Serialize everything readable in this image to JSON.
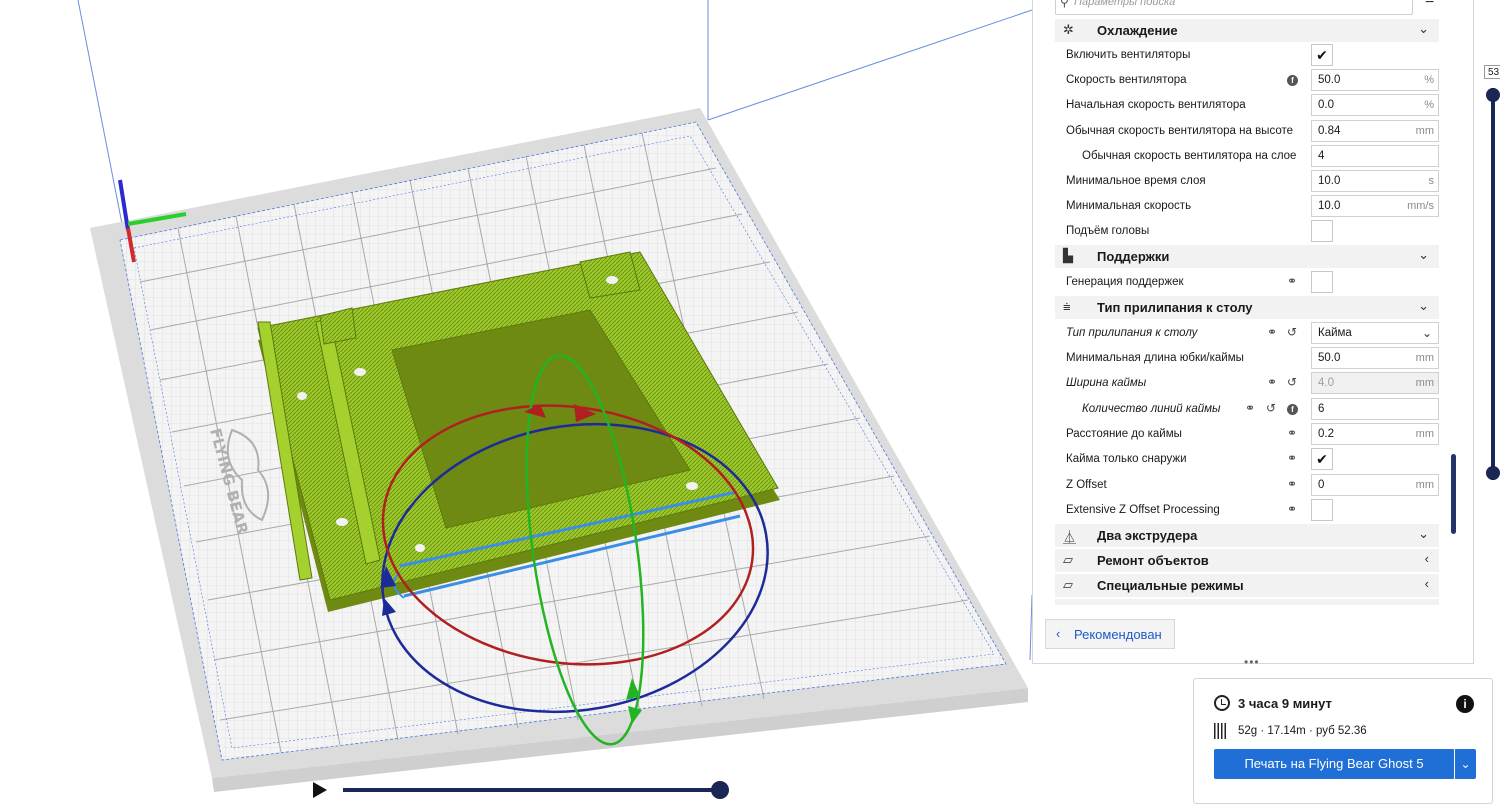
{
  "search": {
    "placeholder": "Параметры поиска"
  },
  "cooling": {
    "title": "Охлаждение",
    "rows": [
      {
        "label": "Включить вентиляторы",
        "type": "check",
        "checked": true,
        "value": "✔"
      },
      {
        "label": "Скорость вентилятора",
        "value": "50.0",
        "unit": "%"
      },
      {
        "label": "Начальная скорость вентилятора",
        "value": "0.0",
        "unit": "%"
      },
      {
        "label": "Обычная скорость вентилятора на высоте",
        "value": "0.84",
        "unit": "mm"
      },
      {
        "label": "Обычная скорость вентилятора на слое",
        "value": "4",
        "unit": ""
      },
      {
        "label": "Минимальное время слоя",
        "value": "10.0",
        "unit": "s"
      },
      {
        "label": "Минимальная скорость",
        "value": "10.0",
        "unit": "mm/s"
      },
      {
        "label": "Подъём головы",
        "type": "check",
        "checked": false,
        "value": ""
      }
    ]
  },
  "supports": {
    "title": "Поддержки",
    "rows": [
      {
        "label": "Генерация поддержек",
        "type": "check",
        "checked": false,
        "value": ""
      }
    ]
  },
  "adhesion": {
    "title": "Тип прилипания к столу",
    "rows": [
      {
        "label": "Тип прилипания к столу",
        "value": "Кайма"
      },
      {
        "label": "Минимальная длина юбки/каймы",
        "value": "50.0",
        "unit": "mm"
      },
      {
        "label": "Ширина каймы",
        "value": "4.0",
        "unit": "mm"
      },
      {
        "label": "Количество линий каймы",
        "value": "6",
        "unit": ""
      },
      {
        "label": "Расстояние до каймы",
        "value": "0.2",
        "unit": "mm"
      },
      {
        "label": "Кайма только снаружи",
        "type": "check",
        "checked": true,
        "value": "✔"
      },
      {
        "label": "Z Offset",
        "value": "0",
        "unit": "mm"
      },
      {
        "label": "Extensive Z Offset Processing",
        "type": "check",
        "checked": false,
        "value": ""
      }
    ]
  },
  "categories": [
    {
      "label": "Два экструдера",
      "expanded": true,
      "chevron": "⌄"
    },
    {
      "label": "Ремонт объектов",
      "expanded": false,
      "chevron": "‹"
    },
    {
      "label": "Специальные режимы",
      "expanded": false,
      "chevron": "‹"
    }
  ],
  "recommended_button": {
    "label": "Рекомендован",
    "icon": "chevron-left-icon"
  },
  "print": {
    "time": "3 часа 9 минут",
    "material": "52g · 17.14m · руб 52.36",
    "button": "Печать на Flying Bear Ghost 5"
  },
  "layer_slider": {
    "value": "53"
  },
  "viewport": {
    "logo_text": "FLYING BEAR",
    "model_color": "#9bc92a",
    "bed_color": "#e6e6e6",
    "rotate_red": "#b02020",
    "rotate_green": "#22b422",
    "rotate_blue": "#1c2a9a"
  },
  "playback": {
    "progress": 1.0
  }
}
